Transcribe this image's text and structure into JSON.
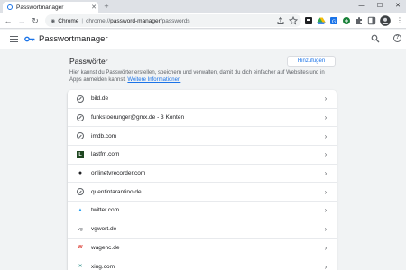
{
  "browser": {
    "tab_title": "Passwortmanager",
    "tab_close": "✕",
    "new_tab": "+",
    "omnibox": {
      "scheme_label": "Chrome",
      "separator": "|",
      "url_scheme": "chrome://",
      "url_host": "password-manager",
      "url_path": "/passwords"
    }
  },
  "app": {
    "title": "Passwortmanager"
  },
  "main": {
    "section_title": "Passwörter",
    "add_button": "Hinzufügen",
    "description": "Hier kannst du Passwörter erstellen, speichern und verwalten, damit du dich einfacher auf Websites und in Apps anmelden kannst.",
    "learn_more": "Weitere Informationen"
  },
  "passwords": [
    {
      "site": "bild.de",
      "icon": "globe-icon"
    },
    {
      "site": "funkstoerunger@gmx.de - 3 Konten",
      "icon": "globe-icon"
    },
    {
      "site": "imdb.com",
      "icon": "globe-icon"
    },
    {
      "site": "lastfm.com",
      "icon": "lastfm-icon"
    },
    {
      "site": "onlinetvrecorder.com",
      "icon": "otr-icon"
    },
    {
      "site": "quentintarantino.de",
      "icon": "globe-icon"
    },
    {
      "site": "twitter.com",
      "icon": "twitter-icon"
    },
    {
      "site": "vgwort.de",
      "icon": "vgwort-icon"
    },
    {
      "site": "wagenc.de",
      "icon": "w-icon"
    },
    {
      "site": "xing.com",
      "icon": "xing-icon"
    }
  ],
  "colors": {
    "accent": "#1a73e8",
    "background": "#f1f3f4",
    "text": "#202124"
  }
}
